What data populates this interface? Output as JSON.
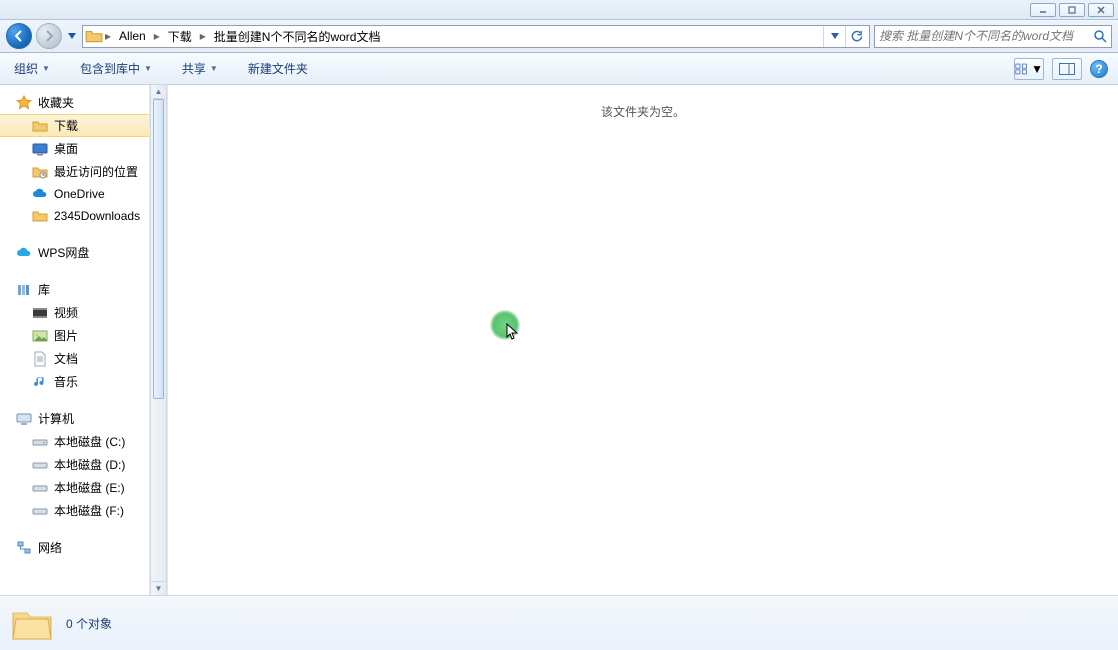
{
  "window_controls": {
    "minimize": "minimize",
    "maximize": "maximize",
    "close": "close"
  },
  "breadcrumb": {
    "items": [
      "Allen",
      "下载",
      "批量创建N个不同名的word文档"
    ]
  },
  "search": {
    "placeholder": "搜索 批量创建N个不同名的word文档"
  },
  "toolbar": {
    "organize": "组织",
    "include": "包含到库中",
    "share": "共享",
    "newfolder": "新建文件夹"
  },
  "sidebar": {
    "favorites": {
      "label": "收藏夹"
    },
    "fav_items": [
      {
        "label": "下载",
        "icon": "folder"
      },
      {
        "label": "桌面",
        "icon": "desktop"
      },
      {
        "label": "最近访问的位置",
        "icon": "recent"
      },
      {
        "label": "OneDrive",
        "icon": "cloud-blue"
      },
      {
        "label": "2345Downloads",
        "icon": "folder"
      }
    ],
    "wps": {
      "label": "WPS网盘"
    },
    "libraries": {
      "label": "库"
    },
    "lib_items": [
      {
        "label": "视频",
        "icon": "video"
      },
      {
        "label": "图片",
        "icon": "picture"
      },
      {
        "label": "文档",
        "icon": "document"
      },
      {
        "label": "音乐",
        "icon": "music"
      }
    ],
    "computer": {
      "label": "计算机"
    },
    "drives": [
      {
        "label": "本地磁盘 (C:)"
      },
      {
        "label": "本地磁盘 (D:)"
      },
      {
        "label": "本地磁盘 (E:)"
      },
      {
        "label": "本地磁盘 (F:)"
      }
    ],
    "network": {
      "label": "网络"
    }
  },
  "content": {
    "empty": "该文件夹为空。"
  },
  "status": {
    "text": "0 个对象"
  }
}
